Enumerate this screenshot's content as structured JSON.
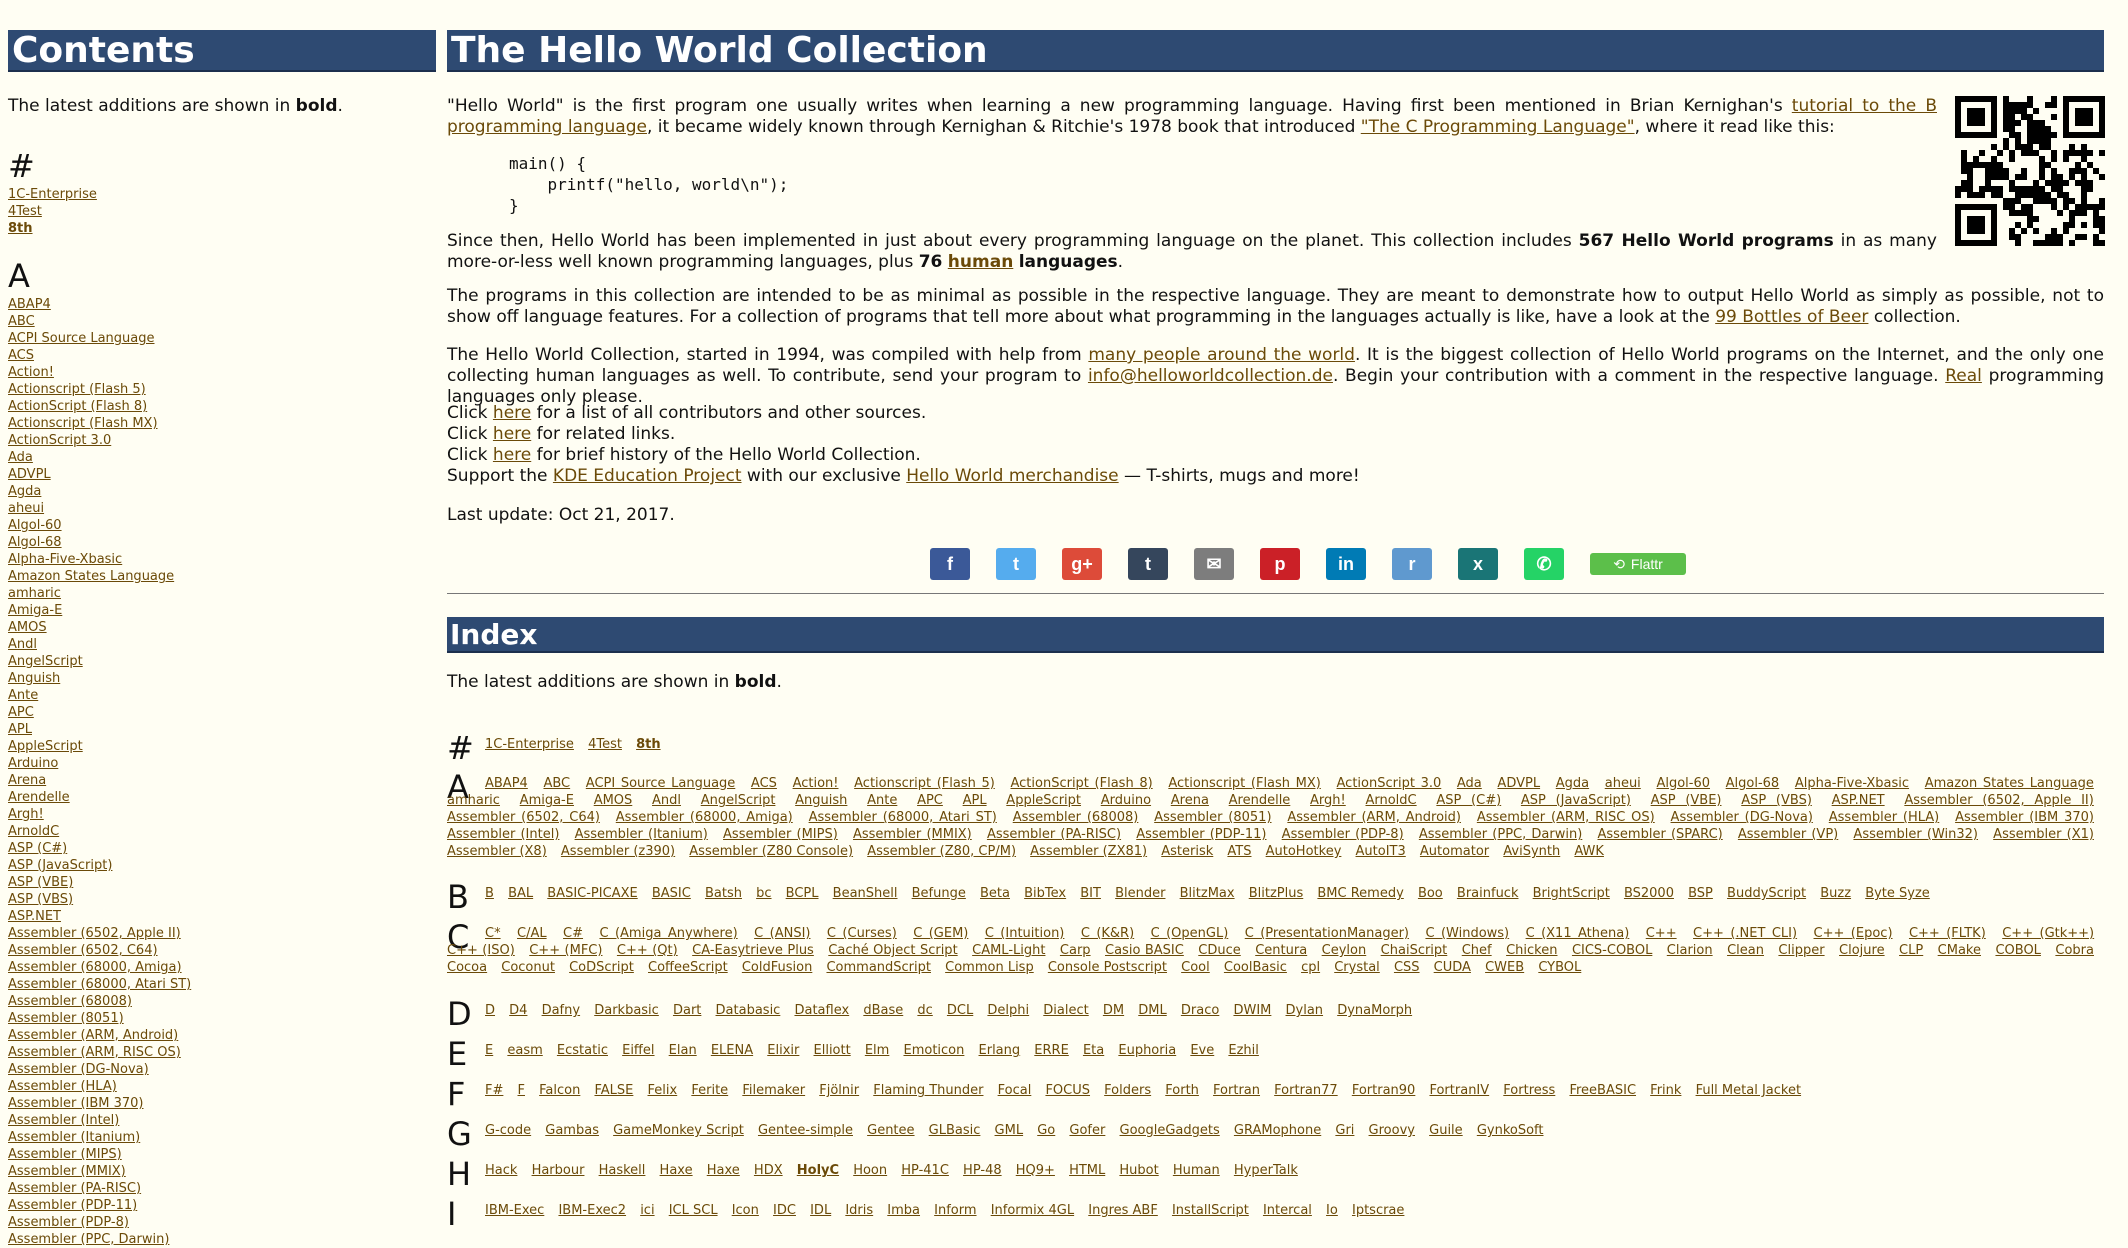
{
  "sidebar": {
    "title": "Contents",
    "note_pre": "The latest additions are shown in ",
    "note_bold": "bold",
    "note_post": ".",
    "groups": [
      {
        "letter": "#",
        "items": [
          {
            "t": "1C-Enterprise"
          },
          {
            "t": "4Test"
          },
          {
            "t": "8th",
            "b": true
          }
        ]
      },
      {
        "letter": "A",
        "items": [
          {
            "t": "ABAP4"
          },
          {
            "t": "ABC"
          },
          {
            "t": "ACPI Source Language"
          },
          {
            "t": "ACS"
          },
          {
            "t": "Action!"
          },
          {
            "t": "Actionscript (Flash 5)"
          },
          {
            "t": "ActionScript (Flash 8)"
          },
          {
            "t": "Actionscript (Flash MX)"
          },
          {
            "t": "ActionScript 3.0"
          },
          {
            "t": "Ada"
          },
          {
            "t": "ADVPL"
          },
          {
            "t": "Agda"
          },
          {
            "t": "aheui"
          },
          {
            "t": "Algol-60"
          },
          {
            "t": "Algol-68"
          },
          {
            "t": "Alpha-Five-Xbasic"
          },
          {
            "t": "Amazon States Language"
          },
          {
            "t": "amharic"
          },
          {
            "t": "Amiga-E"
          },
          {
            "t": "AMOS"
          },
          {
            "t": "Andl"
          },
          {
            "t": "AngelScript"
          },
          {
            "t": "Anguish"
          },
          {
            "t": "Ante"
          },
          {
            "t": "APC"
          },
          {
            "t": "APL"
          },
          {
            "t": "AppleScript"
          },
          {
            "t": "Arduino"
          },
          {
            "t": "Arena"
          },
          {
            "t": "Arendelle"
          },
          {
            "t": "Argh!"
          },
          {
            "t": "ArnoldC"
          },
          {
            "t": "ASP (C#)"
          },
          {
            "t": "ASP (JavaScript)"
          },
          {
            "t": "ASP (VBE)"
          },
          {
            "t": "ASP (VBS)"
          },
          {
            "t": "ASP.NET"
          },
          {
            "t": "Assembler (6502, Apple II)"
          },
          {
            "t": "Assembler (6502, C64)"
          },
          {
            "t": "Assembler (68000, Amiga)"
          },
          {
            "t": "Assembler (68000, Atari ST)"
          },
          {
            "t": "Assembler (68008)"
          },
          {
            "t": "Assembler (8051)"
          },
          {
            "t": "Assembler (ARM, Android)"
          },
          {
            "t": "Assembler (ARM, RISC OS)"
          },
          {
            "t": "Assembler (DG-Nova)"
          },
          {
            "t": "Assembler (HLA)"
          },
          {
            "t": "Assembler (IBM 370)"
          },
          {
            "t": "Assembler (Intel)"
          },
          {
            "t": "Assembler (Itanium)"
          },
          {
            "t": "Assembler (MIPS)"
          },
          {
            "t": "Assembler (MMIX)"
          },
          {
            "t": "Assembler (PA-RISC)"
          },
          {
            "t": "Assembler (PDP-11)"
          },
          {
            "t": "Assembler (PDP-8)"
          },
          {
            "t": "Assembler (PPC, Darwin)"
          }
        ]
      }
    ]
  },
  "main": {
    "title": "The Hello World Collection",
    "intro": {
      "p1_a": "\"Hello World\" is the first program one usually writes when learning a new programming language. Having first been mentioned in Brian Kernighan's ",
      "p1_link1": "tutorial to the B programming language",
      "p1_b": ", it became widely known through Kernighan & Ritchie's 1978 book that introduced ",
      "p1_link2": "\"The C Programming Language\"",
      "p1_c": ", where it read like this:",
      "code": "main() {\n    printf(\"hello, world\\n\");\n}",
      "p2_a": "Since then, Hello World has been implemented in just about every programming language on the planet. This collection includes ",
      "p2_b1": "567 Hello World programs",
      "p2_c": " in as many more-or-less well known programming languages, plus ",
      "p2_b2": "76",
      "p2_link": "human",
      "p2_b3": "languages",
      "p2_d": "."
    },
    "para3_a": "The programs in this collection are intended to be as minimal as possible in the respective language. They are meant to demonstrate how to output Hello World as simply as possible, not to show off language features. For a collection of programs that tell more about what programming in the languages actually is like, have a look at the ",
    "para3_link": "99 Bottles of Beer",
    "para3_b": " collection.",
    "para4_a": "The Hello World Collection, started in 1994, was compiled with help from ",
    "para4_link1": "many people around the world",
    "para4_b": ". It is the biggest collection of Hello World programs on the Internet, and the only one collecting human languages as well. To contribute, send your program to ",
    "para4_link2": "info@helloworldcollection.de",
    "para4_c": ". Begin your contribution with a comment in the respective language. ",
    "para4_link3": "Real",
    "para4_d": " programming languages only please.",
    "clicks": [
      {
        "pre": "Click ",
        "link": "here",
        "post": " for a list of all contributors and other sources."
      },
      {
        "pre": "Click ",
        "link": "here",
        "post": " for related links."
      },
      {
        "pre": "Click ",
        "link": "here",
        "post": " for brief history of the Hello World Collection."
      }
    ],
    "support_pre": "Support the ",
    "support_link1": "KDE Education Project",
    "support_mid": " with our exclusive ",
    "support_link2": "Hello World merchandise",
    "support_post": " — T-shirts, mugs and more!",
    "last_update": "Last update: Oct 21, 2017.",
    "share": [
      {
        "name": "facebook-icon",
        "glyph": "f",
        "color": "#3b5998"
      },
      {
        "name": "twitter-icon",
        "glyph": "t",
        "color": "#55acee"
      },
      {
        "name": "google-plus-icon",
        "glyph": "g+",
        "color": "#dd4b39"
      },
      {
        "name": "tumblr-icon",
        "glyph": "t",
        "color": "#35465c"
      },
      {
        "name": "email-icon",
        "glyph": "✉",
        "color": "#7d7d7d"
      },
      {
        "name": "pinterest-icon",
        "glyph": "p",
        "color": "#cb2027"
      },
      {
        "name": "linkedin-icon",
        "glyph": "in",
        "color": "#007bb5"
      },
      {
        "name": "reddit-icon",
        "glyph": "r",
        "color": "#5f99cf"
      },
      {
        "name": "xing-icon",
        "glyph": "x",
        "color": "#1a7576"
      },
      {
        "name": "whatsapp-icon",
        "glyph": "✆",
        "color": "#25d366"
      }
    ],
    "flattr_label": "Flattr",
    "index_title": "Index",
    "index_note_pre": "The latest additions are shown in ",
    "index_note_bold": "bold",
    "index_note_post": ".",
    "index": [
      {
        "letter": "#",
        "items": [
          "1C-Enterprise",
          "4Test",
          "*8th"
        ]
      },
      {
        "letter": "A",
        "items": [
          "ABAP4",
          "ABC",
          "ACPI Source Language",
          "ACS",
          "Action!",
          "Actionscript (Flash 5)",
          "ActionScript (Flash 8)",
          "Actionscript (Flash MX)",
          "ActionScript 3.0",
          "Ada",
          "ADVPL",
          "Agda",
          "aheui",
          "Algol-60",
          "Algol-68",
          "Alpha-Five-Xbasic",
          "Amazon States Language",
          "amharic",
          "Amiga-E",
          "AMOS",
          "Andl",
          "AngelScript",
          "Anguish",
          "Ante",
          "APC",
          "APL",
          "AppleScript",
          "Arduino",
          "Arena",
          "Arendelle",
          "Argh!",
          "ArnoldC",
          "ASP (C#)",
          "ASP (JavaScript)",
          "ASP (VBE)",
          "ASP (VBS)",
          "ASP.NET",
          "Assembler (6502, Apple II)",
          "Assembler (6502, C64)",
          "Assembler (68000, Amiga)",
          "Assembler (68000, Atari ST)",
          "Assembler (68008)",
          "Assembler (8051)",
          "Assembler (ARM, Android)",
          "Assembler (ARM, RISC OS)",
          "Assembler (DG-Nova)",
          "Assembler (HLA)",
          "Assembler (IBM 370)",
          "Assembler (Intel)",
          "Assembler (Itanium)",
          "Assembler (MIPS)",
          "Assembler (MMIX)",
          "Assembler (PA-RISC)",
          "Assembler (PDP-11)",
          "Assembler (PDP-8)",
          "Assembler (PPC, Darwin)",
          "Assembler (SPARC)",
          "Assembler (VP)",
          "Assembler (Win32)",
          "Assembler (X1)",
          "Assembler (X8)",
          "Assembler (z390)",
          "Assembler (Z80 Console)",
          "Assembler (Z80, CP/M)",
          "Assembler (ZX81)",
          "Asterisk",
          "ATS",
          "AutoHotkey",
          "AutoIT3",
          "Automator",
          "AviSynth",
          "AWK"
        ]
      },
      {
        "letter": "B",
        "items": [
          "B",
          "BAL",
          "BASIC-PICAXE",
          "BASIC",
          "Batsh",
          "bc",
          "BCPL",
          "BeanShell",
          "Befunge",
          "Beta",
          "BibTex",
          "BIT",
          "Blender",
          "BlitzMax",
          "BlitzPlus",
          "BMC Remedy",
          "Boo",
          "Brainfuck",
          "BrightScript",
          "BS2000",
          "BSP",
          "BuddyScript",
          "Buzz",
          "Byte Syze"
        ]
      },
      {
        "letter": "C",
        "items": [
          "C*",
          "C/AL",
          "C#",
          "C (Amiga Anywhere)",
          "C (ANSI)",
          "C (Curses)",
          "C (GEM)",
          "C (Intuition)",
          "C (K&R)",
          "C (OpenGL)",
          "C (PresentationManager)",
          "C (Windows)",
          "C (X11 Athena)",
          "C++",
          "C++ (.NET CLI)",
          "C++ (Epoc)",
          "C++ (FLTK)",
          "C++ (Gtk++)",
          "C++ (ISO)",
          "C++ (MFC)",
          "C++ (Qt)",
          "CA-Easytrieve Plus",
          "Caché Object Script",
          "CAML-Light",
          "Carp",
          "Casio BASIC",
          "CDuce",
          "Centura",
          "Ceylon",
          "ChaiScript",
          "Chef",
          "Chicken",
          "CICS-COBOL",
          "Clarion",
          "Clean",
          "Clipper",
          "Clojure",
          "CLP",
          "CMake",
          "COBOL",
          "Cobra",
          "Cocoa",
          "Coconut",
          "CoDScript",
          "CoffeeScript",
          "ColdFusion",
          "CommandScript",
          "Common Lisp",
          "Console Postscript",
          "Cool",
          "CoolBasic",
          "cpl",
          "Crystal",
          "CSS",
          "CUDA",
          "CWEB",
          "CYBOL"
        ]
      },
      {
        "letter": "D",
        "items": [
          "D",
          "D4",
          "Dafny",
          "Darkbasic",
          "Dart",
          "Databasic",
          "Dataflex",
          "dBase",
          "dc",
          "DCL",
          "Delphi",
          "Dialect",
          "DM",
          "DML",
          "Draco",
          "DWIM",
          "Dylan",
          "DynaMorph"
        ]
      },
      {
        "letter": "E",
        "items": [
          "E",
          "easm",
          "Ecstatic",
          "Eiffel",
          "Elan",
          "ELENA",
          "Elixir",
          "Elliott",
          "Elm",
          "Emoticon",
          "Erlang",
          "ERRE",
          "Eta",
          "Euphoria",
          "Eve",
          "Ezhil"
        ]
      },
      {
        "letter": "F",
        "items": [
          "F#",
          "F",
          "Falcon",
          "FALSE",
          "Felix",
          "Ferite",
          "Filemaker",
          "Fjölnir",
          "Flaming Thunder",
          "Focal",
          "FOCUS",
          "Folders",
          "Forth",
          "Fortran",
          "Fortran77",
          "Fortran90",
          "FortranIV",
          "Fortress",
          "FreeBASIC",
          "Frink",
          "Full Metal Jacket"
        ]
      },
      {
        "letter": "G",
        "items": [
          "G-code",
          "Gambas",
          "GameMonkey Script",
          "Gentee-simple",
          "Gentee",
          "GLBasic",
          "GML",
          "Go",
          "Gofer",
          "GoogleGadgets",
          "GRAMophone",
          "Gri",
          "Groovy",
          "Guile",
          "GynkoSoft"
        ]
      },
      {
        "letter": "H",
        "items": [
          "Hack",
          "Harbour",
          "Haskell",
          "Haxe",
          "Haxe",
          "HDX",
          "*HolyC",
          "Hoon",
          "HP-41C",
          "HP-48",
          "HQ9+",
          "HTML",
          "Hubot",
          "Human",
          "HyperTalk"
        ]
      },
      {
        "letter": "I",
        "items": [
          "IBM-Exec",
          "IBM-Exec2",
          "ici",
          "ICL SCL",
          "Icon",
          "IDC",
          "IDL",
          "Idris",
          "Imba",
          "Inform",
          "Informix 4GL",
          "Ingres ABF",
          "InstallScript",
          "Intercal",
          "Io",
          "Iptscrae"
        ]
      }
    ]
  }
}
